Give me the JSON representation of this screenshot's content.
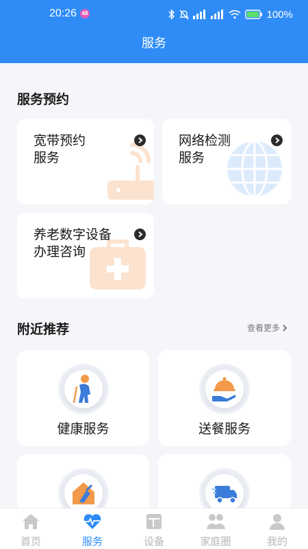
{
  "status_bar": {
    "time": "20:26",
    "badge": "48",
    "battery": "100%"
  },
  "header": {
    "title": "服务"
  },
  "booking": {
    "title": "服务预约",
    "cards": [
      {
        "line1": "宽带预约",
        "line2": "服务",
        "icon": "router-icon"
      },
      {
        "line1": "网络检测",
        "line2": "服务",
        "icon": "globe-icon"
      },
      {
        "line1": "养老数字设备",
        "line2": "办理咨询",
        "icon": "medical-kit-icon"
      }
    ]
  },
  "nearby": {
    "title": "附近推荐",
    "more": "查看更多",
    "items": [
      {
        "label": "健康服务",
        "icon": "elderly-person-icon"
      },
      {
        "label": "送餐服务",
        "icon": "meal-delivery-icon"
      },
      {
        "label": "",
        "icon": "house-cleaning-icon"
      },
      {
        "label": "",
        "icon": "delivery-truck-icon"
      }
    ]
  },
  "tabbar": {
    "tabs": [
      {
        "label": "首页",
        "icon": "home-icon",
        "active": false
      },
      {
        "label": "服务",
        "icon": "heartbeat-icon",
        "active": true
      },
      {
        "label": "设备",
        "icon": "device-icon",
        "active": false
      },
      {
        "label": "家庭圈",
        "icon": "family-icon",
        "active": false
      },
      {
        "label": "我的",
        "icon": "user-icon",
        "active": false
      }
    ]
  },
  "colors": {
    "primary": "#2F8CF7",
    "accent_orange": "#F2994A",
    "text": "#1A1A1A",
    "inactive": "#B5B5B5"
  }
}
